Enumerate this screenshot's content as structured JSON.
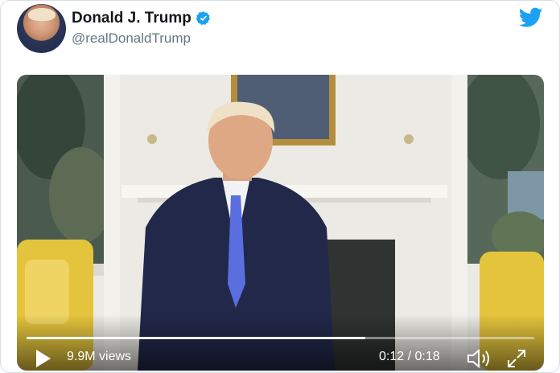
{
  "author": {
    "name": "Donald J. Trump",
    "handle": "@realDonaldTrump",
    "verified": true
  },
  "brand": {
    "icon": "twitter-bird-icon",
    "color": "#1da1f2"
  },
  "video": {
    "views": "9.9M views",
    "current_time": "0:12",
    "separator": " / ",
    "duration": "0:18",
    "progress": 0.667,
    "controls": [
      "play-icon",
      "volume-icon",
      "fullscreen-icon"
    ]
  }
}
